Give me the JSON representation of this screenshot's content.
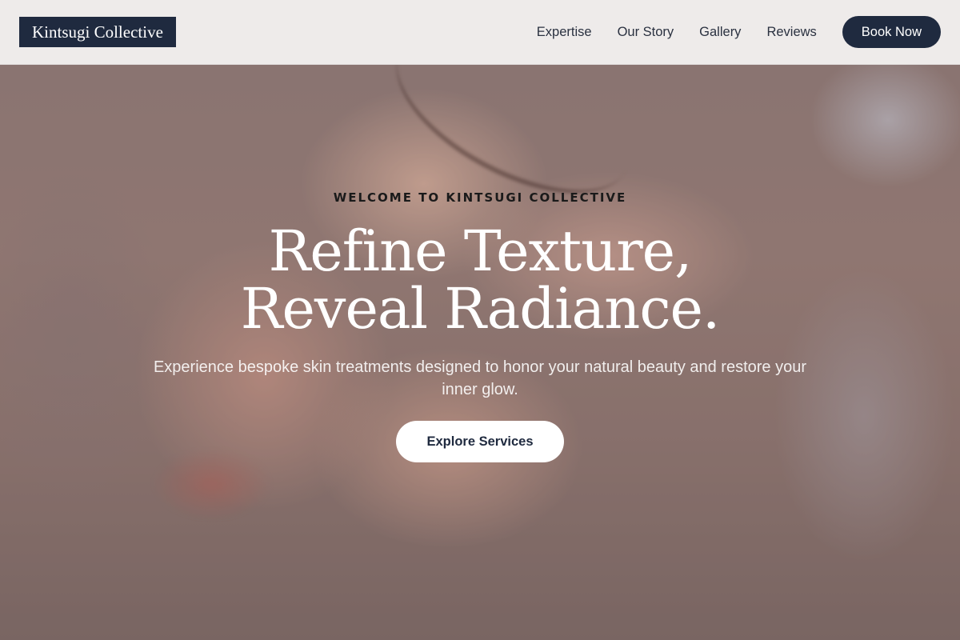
{
  "header": {
    "logo_text": "Kintsugi Collective",
    "nav": [
      {
        "label": "Expertise"
      },
      {
        "label": "Our Story"
      },
      {
        "label": "Gallery"
      },
      {
        "label": "Reviews"
      }
    ],
    "cta_label": "Book Now"
  },
  "hero": {
    "eyebrow": "WELCOME TO KINTSUGI COLLECTIVE",
    "headline_line1": "Refine Texture,",
    "headline_line2": "Reveal Radiance.",
    "subtext": "Experience bespoke skin treatments designed to honor your natural beauty and restore your inner glow.",
    "cta_label": "Explore Services"
  },
  "colors": {
    "brand_navy": "#1f2a3f",
    "header_bg": "#f5f4f3",
    "button_text": "#1f2a3f"
  }
}
